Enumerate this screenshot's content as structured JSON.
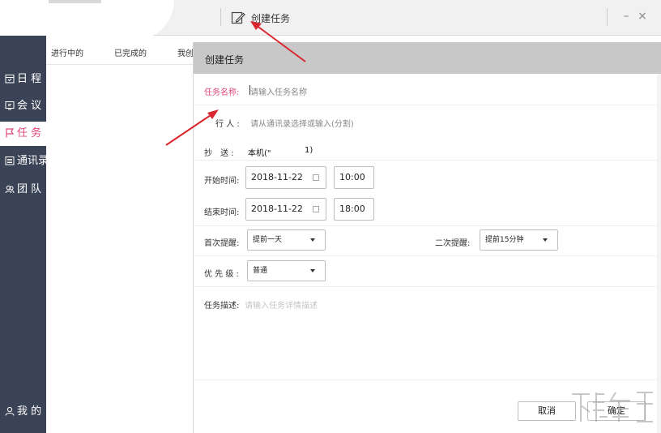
{
  "titlebar": {
    "create_task_label": "创建任务",
    "minimize_symbol": "–",
    "close_symbol": "×"
  },
  "sidebar": {
    "items": [
      {
        "label": "日 程",
        "icon": "calendar-icon"
      },
      {
        "label": "会 议",
        "icon": "meeting-icon"
      },
      {
        "label": "任 务",
        "icon": "flag-icon",
        "active": true
      },
      {
        "label": "通讯录",
        "icon": "contacts-icon"
      },
      {
        "label": "团 队",
        "icon": "team-icon"
      }
    ],
    "profile": {
      "label": "我 的",
      "icon": "user-icon"
    }
  },
  "tabs": [
    {
      "label": "进行中的",
      "active": true
    },
    {
      "label": "已完成的"
    },
    {
      "label": "我创"
    }
  ],
  "dialog": {
    "title": "创建任务",
    "task_name": {
      "label": "任务名称:",
      "placeholder": "请输入任务名称"
    },
    "assignee": {
      "label": "行 人 :",
      "placeholder": "请从通讯录选择或输入(分割)"
    },
    "cc": {
      "label": "抄　送 :",
      "value": "本机(\"",
      "value_tail": "1)"
    },
    "start": {
      "label": "开始时间:",
      "date": "2018-11-22",
      "time": "10:00"
    },
    "end": {
      "label": "结束时间:",
      "date": "2018-11-22",
      "time": "18:00"
    },
    "first_reminder": {
      "label": "首次提醒:",
      "value": "提前一天"
    },
    "second_reminder": {
      "label": "二次提醒:",
      "value": "提前15分钟"
    },
    "priority": {
      "label": "优 先 级 :",
      "value": "普通"
    },
    "description": {
      "label": "任务描述:",
      "placeholder": "请输入任务详情描述"
    },
    "cancel_label": "取消",
    "confirm_label": "确定"
  },
  "colors": {
    "accent": "#e2467b",
    "sidebar_bg": "#3b4456",
    "arrow": "#d9262f"
  }
}
